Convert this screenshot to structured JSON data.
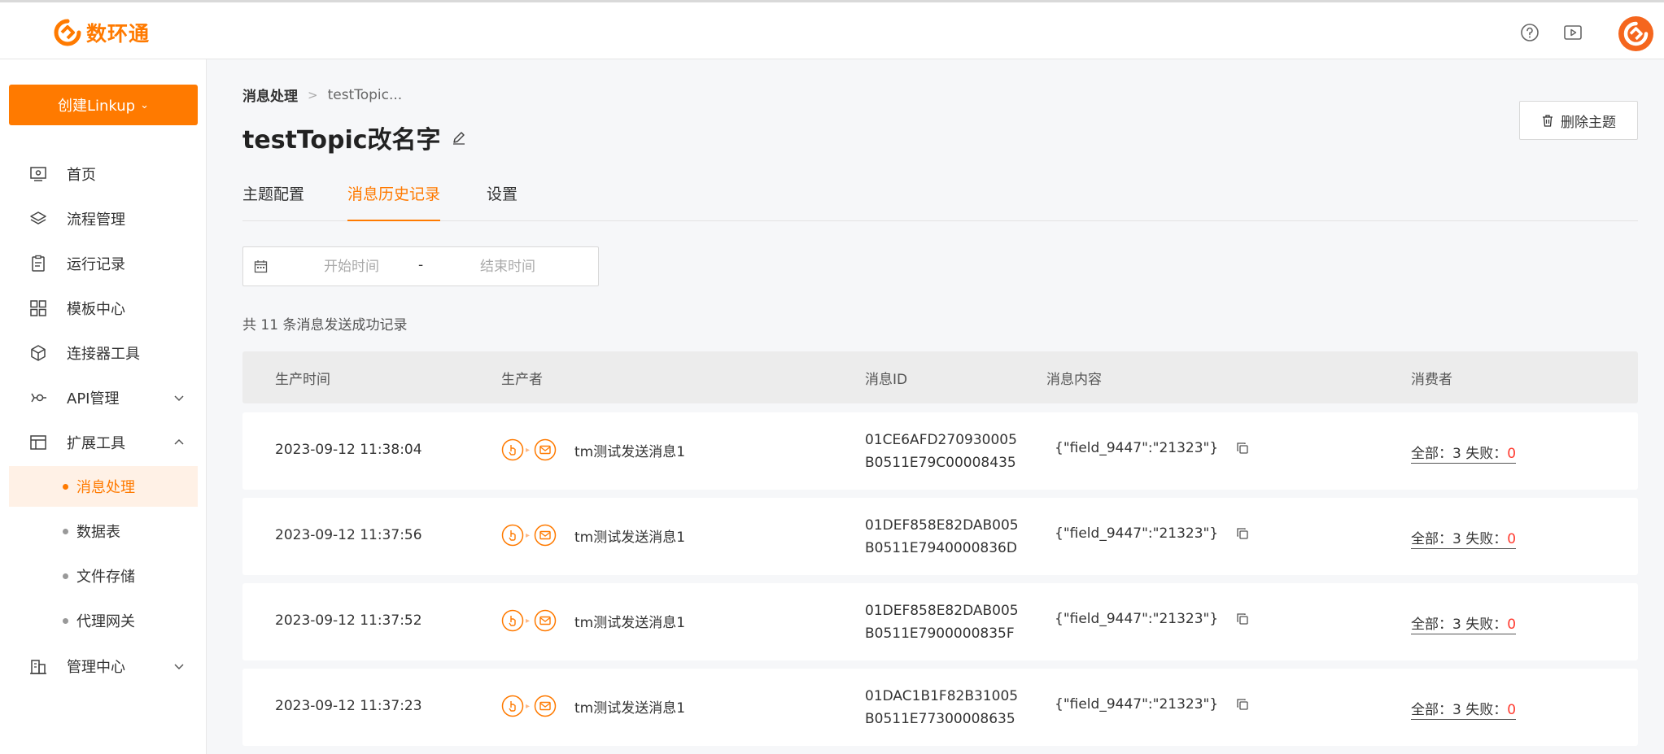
{
  "app": {
    "logo_text": "数环通",
    "brand_color": "#ff7a00",
    "top_icons": [
      "help-circle-icon",
      "video-icon"
    ]
  },
  "sidebar": {
    "create_button": "创建Linkup",
    "items": [
      {
        "label": "首页",
        "icon": "home-icon"
      },
      {
        "label": "流程管理",
        "icon": "layers-icon"
      },
      {
        "label": "运行记录",
        "icon": "clipboard-icon"
      },
      {
        "label": "模板中心",
        "icon": "grid-icon"
      },
      {
        "label": "连接器工具",
        "icon": "cube-icon"
      },
      {
        "label": "API管理",
        "icon": "api-icon"
      },
      {
        "label": "扩展工具",
        "icon": "layout-icon"
      }
    ],
    "sub_items": [
      {
        "label": "消息处理",
        "active": true
      },
      {
        "label": "数据表"
      },
      {
        "label": "文件存储"
      },
      {
        "label": "代理网关"
      }
    ],
    "last_item": {
      "label": "管理中心",
      "icon": "building-icon"
    }
  },
  "breadcrumb": {
    "root": "消息处理",
    "current": "testTopic..."
  },
  "page": {
    "title": "testTopic改名字",
    "delete_button": "删除主题"
  },
  "tabs": [
    {
      "label": "主题配置"
    },
    {
      "label": "消息历史记录",
      "active": true
    },
    {
      "label": "设置"
    }
  ],
  "filter": {
    "start_placeholder": "开始时间",
    "separator": "-",
    "end_placeholder": "结束时间"
  },
  "summary": "共 11 条消息发送成功记录",
  "table": {
    "columns": [
      "生产时间",
      "生产者",
      "消息ID",
      "消息内容",
      "消费者"
    ],
    "rows": [
      {
        "time": "2023-09-12 11:38:04",
        "producer": "tm测试发送消息1",
        "id_line1": "01CE6AFD270930005",
        "id_line2": "B0511E79C00008435",
        "content": "{\"field_9447\":\"21323\"}",
        "consumer_prefix": "全部：3 失败：",
        "fail": "0"
      },
      {
        "time": "2023-09-12 11:37:56",
        "producer": "tm测试发送消息1",
        "id_line1": "01DEF858E82DAB005",
        "id_line2": "B0511E7940000836D",
        "content": "{\"field_9447\":\"21323\"}",
        "consumer_prefix": "全部：3 失败：",
        "fail": "0"
      },
      {
        "time": "2023-09-12 11:37:52",
        "producer": "tm测试发送消息1",
        "id_line1": "01DEF858E82DAB005",
        "id_line2": "B0511E7900000835F",
        "content": "{\"field_9447\":\"21323\"}",
        "consumer_prefix": "全部：3 失败：",
        "fail": "0"
      },
      {
        "time": "2023-09-12 11:37:23",
        "producer": "tm测试发送消息1",
        "id_line1": "01DAC1B1F82B31005",
        "id_line2": "B0511E77300008635",
        "content": "{\"field_9447\":\"21323\"}",
        "consumer_prefix": "全部：3 失败：",
        "fail": "0"
      }
    ]
  }
}
